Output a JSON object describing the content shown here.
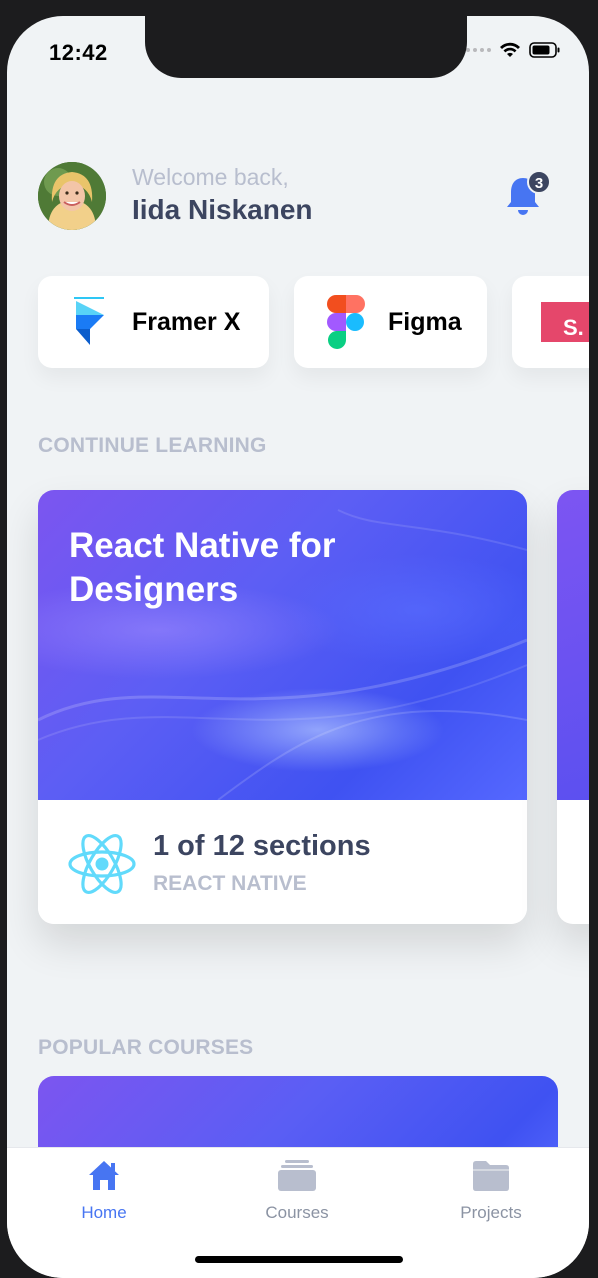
{
  "status_bar": {
    "time": "12:42"
  },
  "header": {
    "welcome": "Welcome back,",
    "name": "Iida Niskanen",
    "notification_count": "3"
  },
  "logos": [
    {
      "label": "Framer X",
      "icon": "framer-logo-icon"
    },
    {
      "label": "Figma",
      "icon": "figma-logo-icon"
    },
    {
      "label": "S.",
      "icon": "studio-logo-icon"
    }
  ],
  "sections": {
    "continue_learning": "CONTINUE LEARNING",
    "popular_courses": "POPULAR COURSES"
  },
  "course": {
    "title": "React Native for Designers",
    "progress": "1 of 12 sections",
    "category": "REACT NATIVE"
  },
  "tabs": [
    {
      "label": "Home",
      "icon": "home-icon",
      "active": true
    },
    {
      "label": "Courses",
      "icon": "courses-icon",
      "active": false
    },
    {
      "label": "Projects",
      "icon": "folder-icon",
      "active": false
    }
  ],
  "colors": {
    "accent": "#4775f2",
    "text_dark": "#3c4560",
    "text_light": "#b8bece",
    "background": "#f0f3f5"
  }
}
